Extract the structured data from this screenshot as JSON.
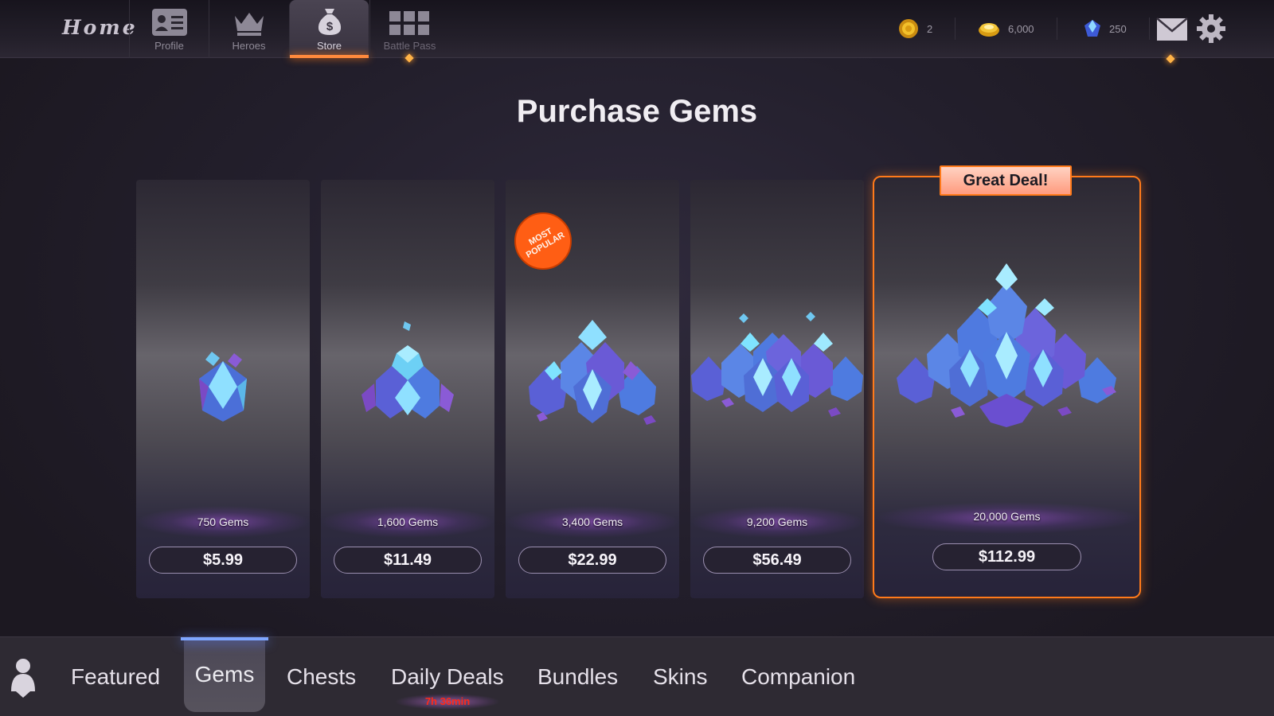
{
  "topbar": {
    "home_label": "Home",
    "tabs": [
      {
        "label": "Profile",
        "icon": "profile-card-icon"
      },
      {
        "label": "Heroes",
        "icon": "crown-icon"
      },
      {
        "label": "Store",
        "icon": "money-bag-icon",
        "active": true
      },
      {
        "label": "Battle Pass",
        "icon": "battle-pass-icon",
        "notification": true
      }
    ],
    "currencies": [
      {
        "icon": "coin-icon",
        "value": "2"
      },
      {
        "icon": "gold-icon",
        "value": "6,000"
      },
      {
        "icon": "gem-icon",
        "value": "250"
      }
    ],
    "mail_icon": "mail-icon",
    "settings_icon": "gear-icon"
  },
  "page_title": "Purchase Gems",
  "offers": [
    {
      "amount": "750 Gems",
      "price": "$5.99"
    },
    {
      "amount": "1,600 Gems",
      "price": "$11.49"
    },
    {
      "amount": "3,400 Gems",
      "price": "$22.99",
      "badge": "MOST POPULAR"
    },
    {
      "amount": "9,200 Gems",
      "price": "$56.49"
    },
    {
      "amount": "20,000 Gems",
      "price": "$112.99",
      "banner": "Great Deal!"
    }
  ],
  "badge": {
    "line1": "MOST",
    "line2": "POPULAR"
  },
  "banner_text": "Great Deal!",
  "bottom_tabs": [
    {
      "label": "Featured"
    },
    {
      "label": "Gems",
      "active": true
    },
    {
      "label": "Chests"
    },
    {
      "label": "Daily Deals",
      "timer": "7h 36min"
    },
    {
      "label": "Bundles"
    },
    {
      "label": "Skins"
    },
    {
      "label": "Companion"
    }
  ],
  "colors": {
    "accent": "#ff7a1a",
    "active_tab_underline": "#7fa6ff",
    "timer": "#ff2a1a"
  }
}
